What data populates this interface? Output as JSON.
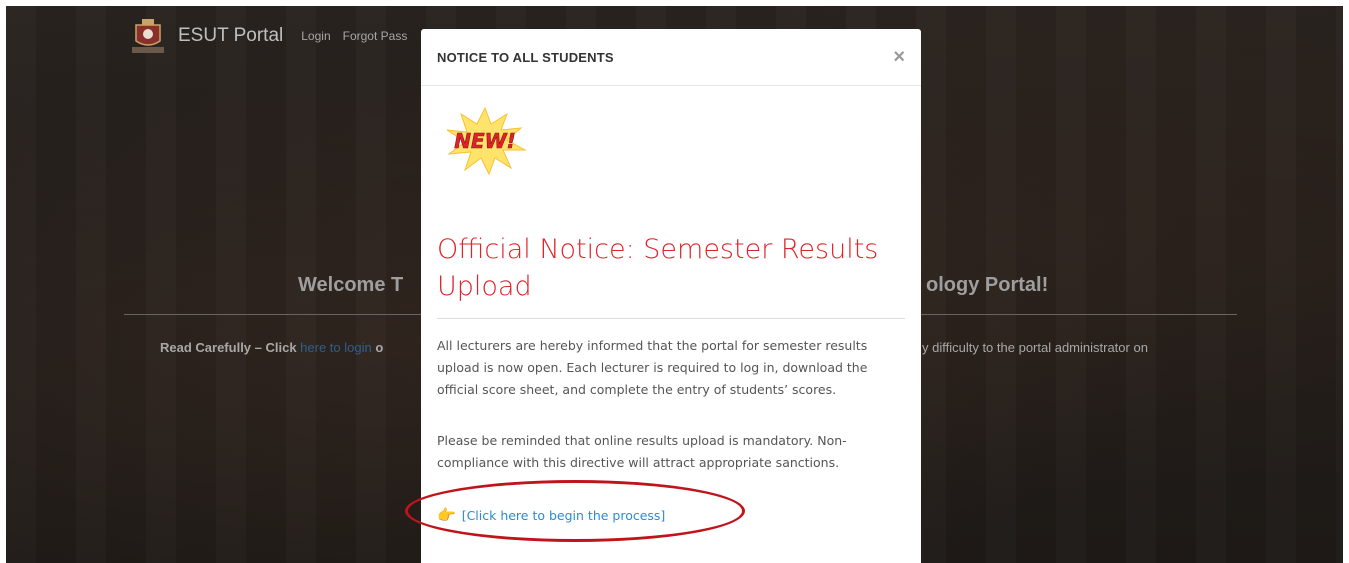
{
  "navbar": {
    "brand": "ESUT Portal",
    "links": [
      "Login",
      "Forgot Pass"
    ]
  },
  "background": {
    "welcome_left": "Welcome T",
    "welcome_right": "ology Portal!",
    "read_left_strong": "Read Carefully – Click ",
    "read_left_link": "here to login",
    "read_left_tail": " o",
    "read_right": "y difficulty to the portal administrator on"
  },
  "modal": {
    "title": "NOTICE TO ALL STUDENTS",
    "close_symbol": "×",
    "badge_text": "NEW!",
    "heading": "Official Notice: Semester Results Upload",
    "paragraph1": "All lecturers are hereby informed that the portal for semester results upload is now open. Each lecturer is required to log in, download the official score sheet, and complete the entry of students’ scores.",
    "paragraph2": "Please be reminded that online results upload is mandatory. Non-compliance with this directive will attract appropriate sanctions.",
    "cta_icon": "pointing-hand-icon",
    "cta_label": "[Click here to begin the process]"
  },
  "colors": {
    "heading_red": "#e0232a",
    "link_blue": "#2a8bd6",
    "annotation_red": "#c0141c"
  }
}
